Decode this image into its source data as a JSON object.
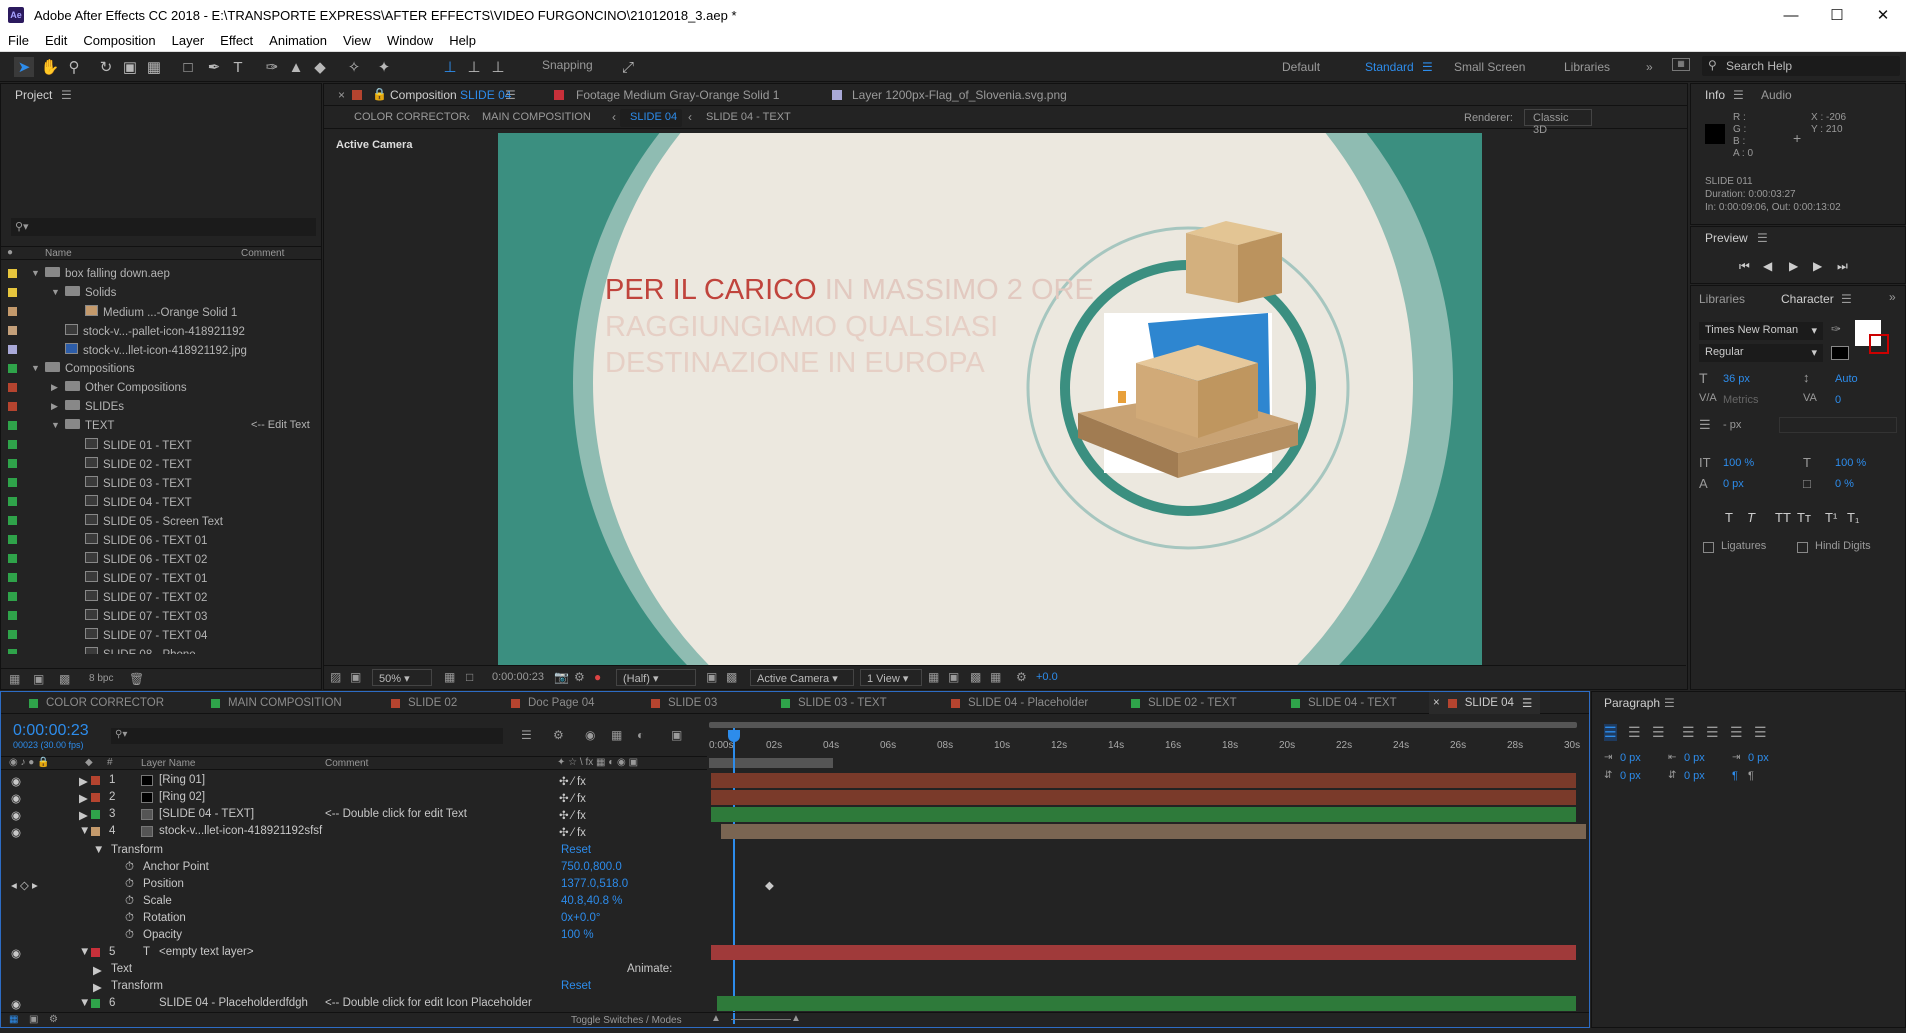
{
  "window": {
    "title": "Adobe After Effects CC 2018 - E:\\TRANSPORTE EXPRESS\\AFTER EFFECTS\\VIDEO FURGONCINO\\21012018_3.aep *",
    "app_icon": "Ae"
  },
  "menu": [
    "File",
    "Edit",
    "Composition",
    "Layer",
    "Effect",
    "Animation",
    "View",
    "Window",
    "Help"
  ],
  "toolbar": {
    "snapping": "Snapping",
    "workspaces": [
      "Default",
      "Standard",
      "Small Screen",
      "Libraries"
    ],
    "active_workspace": "Standard",
    "search_placeholder": "Search Help"
  },
  "project": {
    "title": "Project",
    "columns": {
      "name": "Name",
      "comment": "Comment"
    },
    "items": [
      {
        "label": "box falling down.aep",
        "color": "#e6c53d",
        "comment": ""
      },
      {
        "label": "Solids",
        "color": "#e6c53d",
        "comment": ""
      },
      {
        "label": "Medium ...-Orange Solid 1",
        "color": "#c49a6c",
        "comment": ""
      },
      {
        "label": "stock-v...-pallet-icon-418921192",
        "color": "#c4a07a",
        "comment": ""
      },
      {
        "label": "stock-v...llet-icon-418921192.jpg",
        "color": "#a9a9d8",
        "comment": ""
      },
      {
        "label": "Compositions",
        "color": "#2fa34a",
        "comment": ""
      },
      {
        "label": "Other Compositions",
        "color": "#b5442f",
        "comment": ""
      },
      {
        "label": "SLIDEs",
        "color": "#b5442f",
        "comment": ""
      },
      {
        "label": "TEXT",
        "color": "#2fa34a",
        "comment": "<-- Edit Text"
      },
      {
        "label": "SLIDE 01 - TEXT",
        "color": "#2fa34a",
        "comment": ""
      },
      {
        "label": "SLIDE 02 - TEXT",
        "color": "#2fa34a",
        "comment": ""
      },
      {
        "label": "SLIDE 03 - TEXT",
        "color": "#2fa34a",
        "comment": ""
      },
      {
        "label": "SLIDE 04 - TEXT",
        "color": "#2fa34a",
        "comment": ""
      },
      {
        "label": "SLIDE 05 - Screen Text",
        "color": "#2fa34a",
        "comment": ""
      },
      {
        "label": "SLIDE 06 - TEXT 01",
        "color": "#2fa34a",
        "comment": ""
      },
      {
        "label": "SLIDE 06 - TEXT 02",
        "color": "#2fa34a",
        "comment": ""
      },
      {
        "label": "SLIDE 07 - TEXT 01",
        "color": "#2fa34a",
        "comment": ""
      },
      {
        "label": "SLIDE 07 - TEXT 02",
        "color": "#2fa34a",
        "comment": ""
      },
      {
        "label": "SLIDE 07 - TEXT 03",
        "color": "#2fa34a",
        "comment": ""
      },
      {
        "label": "SLIDE 07 - TEXT 04",
        "color": "#2fa34a",
        "comment": ""
      },
      {
        "label": "SLIDE 08 - Phone",
        "color": "#2fa34a",
        "comment": ""
      }
    ],
    "bpc": "8 bpc"
  },
  "viewer": {
    "tabs": [
      "Composition SLIDE 04",
      "Footage Medium Gray-Orange Solid 1",
      "Layer 1200px-Flag_of_Slovenia.svg.png"
    ],
    "tab_comp_prefix": "Composition",
    "tab_comp_name": "SLIDE 04",
    "breadcrumbs": [
      "COLOR CORRECTOR",
      "MAIN COMPOSITION",
      "SLIDE 04",
      "SLIDE 04 - TEXT"
    ],
    "renderer_label": "Renderer:",
    "renderer": "Classic 3D",
    "camera_label": "Active Camera",
    "canvas_text": {
      "line1_a": "PER IL CARICO",
      "line1_b": " IN MASSIMO 2 ORE",
      "line2": "RAGGIUNGIAMO QUALSIASI",
      "line3": "DESTINAZIONE IN EUROPA"
    },
    "bottom": {
      "zoom": "50%",
      "timecode": "0:00:00:23",
      "resolution": "(Half)",
      "camera": "Active Camera",
      "views": "1 View",
      "exposure": "+0.0"
    }
  },
  "info": {
    "tabs": [
      "Info",
      "Audio"
    ],
    "rgba": [
      "R :",
      "G :",
      "B :",
      "A : 0"
    ],
    "x": "X : -206",
    "y": "Y : 210",
    "layer_name": "SLIDE 011",
    "duration": "Duration: 0:00:03:27",
    "inout": "In: 0:00:09:06, Out: 0:00:13:02"
  },
  "preview": {
    "title": "Preview"
  },
  "character": {
    "tabs": [
      "Libraries",
      "Character"
    ],
    "font": "Times New Roman",
    "style": "Regular",
    "size": "36 px",
    "leading": "Auto",
    "kerning": "Metrics",
    "tracking": "0",
    "stroke": "- px",
    "vscale": "100 %",
    "hscale": "100 %",
    "baseline": "0 px",
    "tsume": "0 %",
    "ligatures": "Ligatures",
    "hindi": "Hindi Digits"
  },
  "timeline": {
    "tabs": [
      {
        "label": "COLOR CORRECTOR",
        "color": "#2fa34a"
      },
      {
        "label": "MAIN COMPOSITION",
        "color": "#2fa34a"
      },
      {
        "label": "SLIDE 02",
        "color": "#b5442f"
      },
      {
        "label": "Doc Page 04",
        "color": "#b5442f"
      },
      {
        "label": "SLIDE 03",
        "color": "#b5442f"
      },
      {
        "label": "SLIDE 03 - TEXT",
        "color": "#2fa34a"
      },
      {
        "label": "SLIDE 04 - Placeholder",
        "color": "#b5442f"
      },
      {
        "label": "SLIDE 02 - TEXT",
        "color": "#2fa34a"
      },
      {
        "label": "SLIDE 04 - TEXT",
        "color": "#2fa34a"
      },
      {
        "label": "SLIDE 04",
        "color": "#b5442f"
      }
    ],
    "timecode": "0:00:00:23",
    "frame_info": "00023 (30.00 fps)",
    "headers": {
      "layer_name": "Layer Name",
      "comment": "Comment"
    },
    "ruler": [
      "0:00s",
      "02s",
      "04s",
      "06s",
      "08s",
      "10s",
      "12s",
      "14s",
      "16s",
      "18s",
      "20s",
      "22s",
      "24s",
      "26s",
      "28s",
      "30s"
    ],
    "layers": [
      {
        "num": "1",
        "name": "[Ring 01]",
        "comment": "",
        "color": "#b5442f"
      },
      {
        "num": "2",
        "name": "[Ring 02]",
        "comment": "",
        "color": "#b5442f"
      },
      {
        "num": "3",
        "name": "[SLIDE 04 - TEXT]",
        "comment": "<-- Double click for edit Text",
        "color": "#2fa34a"
      },
      {
        "num": "4",
        "name": "stock-v...llet-icon-418921192sfsf",
        "comment": "",
        "color": "#c49a6c"
      }
    ],
    "transform": {
      "label": "Transform",
      "reset": "Reset",
      "props": [
        {
          "name": "Anchor Point",
          "value": "750.0,800.0"
        },
        {
          "name": "Position",
          "value": "1377.0,518.0"
        },
        {
          "name": "Scale",
          "value": "40.8,40.8 %"
        },
        {
          "name": "Rotation",
          "value": "0x+0.0°"
        },
        {
          "name": "Opacity",
          "value": "100 %"
        }
      ]
    },
    "layer5": {
      "num": "5",
      "name": "<empty text layer>",
      "text": "Text",
      "animate": "Animate:",
      "transform": "Transform",
      "reset": "Reset"
    },
    "layer6": {
      "num": "6",
      "name": "SLIDE 04 - Placeholderdfdgh",
      "comment": "<-- Double click for edit Icon Placeholder"
    },
    "toggle": "Toggle Switches / Modes"
  },
  "paragraph": {
    "title": "Paragraph",
    "values": [
      "0 px",
      "0 px",
      "0 px",
      "0 px",
      "0 px"
    ]
  }
}
